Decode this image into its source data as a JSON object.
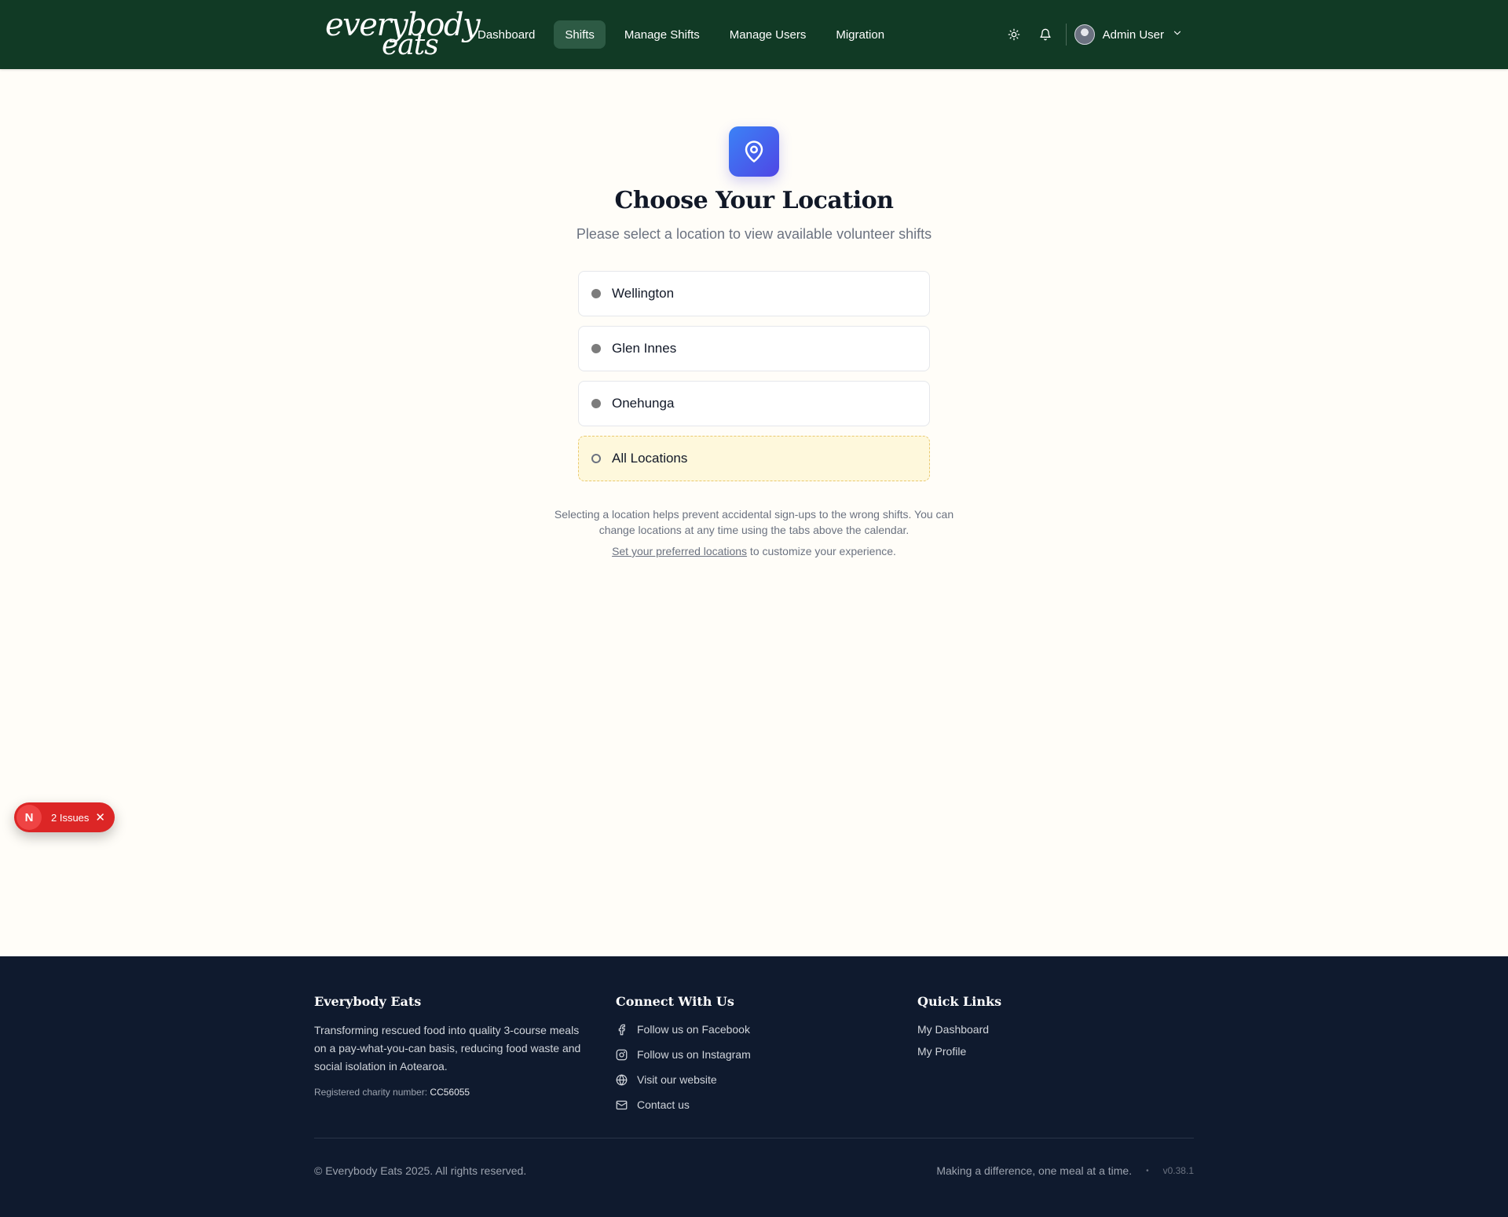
{
  "brand": {
    "logo_line1": "everybody",
    "logo_line2": "eats"
  },
  "nav": {
    "items": [
      {
        "label": "Dashboard"
      },
      {
        "label": "Shifts",
        "active": true
      },
      {
        "label": "Manage Shifts"
      },
      {
        "label": "Manage Users"
      },
      {
        "label": "Migration"
      }
    ]
  },
  "header": {
    "theme_icon": "sun-icon",
    "notifications_icon": "bell-icon",
    "user_name": "Admin User"
  },
  "main": {
    "icon": "map-pin-icon",
    "title": "Choose Your Location",
    "subtitle": "Please select a location to view available volunteer shifts",
    "locations": [
      {
        "label": "Wellington"
      },
      {
        "label": "Glen Innes"
      },
      {
        "label": "Onehunga"
      },
      {
        "label": "All Locations"
      }
    ],
    "note": "Selecting a location helps prevent accidental sign-ups to the wrong shifts. You can change locations at any time using the tabs above the calendar.",
    "pref_link": "Set your preferred locations",
    "pref_rest": " to customize your experience."
  },
  "issues": {
    "badge": "N",
    "count_label": "2 Issues"
  },
  "footer": {
    "about": {
      "title": "Everybody Eats",
      "description": "Transforming rescued food into quality 3-course meals on a pay-what-you-can basis, reducing food waste and social isolation in Aotearoa.",
      "charity_label": "Registered charity number: ",
      "charity_number": "CC56055"
    },
    "connect": {
      "title": "Connect With Us",
      "links": [
        {
          "label": "Follow us on Facebook",
          "icon": "facebook-icon"
        },
        {
          "label": "Follow us on Instagram",
          "icon": "instagram-icon"
        },
        {
          "label": "Visit our website",
          "icon": "globe-icon"
        },
        {
          "label": "Contact us",
          "icon": "mail-icon"
        }
      ]
    },
    "quick": {
      "title": "Quick Links",
      "links": [
        {
          "label": "My Dashboard"
        },
        {
          "label": "My Profile"
        }
      ]
    },
    "copyright": "© Everybody Eats 2025. All rights reserved.",
    "tagline": "Making a difference, one meal at a time.",
    "separator": "•",
    "version": "v0.38.1"
  },
  "colors": {
    "header_bg": "#113a25",
    "page_bg": "#fffdf8",
    "accent_blue": "#4f46e5",
    "footer_bg": "#0f1a2e",
    "issues_red": "#dc2626"
  }
}
